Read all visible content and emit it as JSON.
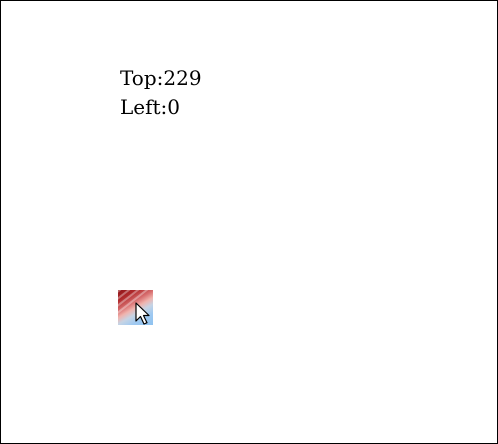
{
  "readout": {
    "top_line": "Top:229",
    "left_line": "Left:0"
  },
  "draggable": {
    "name": "drag-square"
  },
  "cursor": {
    "icon": "arrow-cursor-icon"
  },
  "colors": {
    "square_dark_red": "#8e1418",
    "square_light_blue": "#8ec2f0",
    "border": "#000000",
    "background": "#ffffff"
  }
}
